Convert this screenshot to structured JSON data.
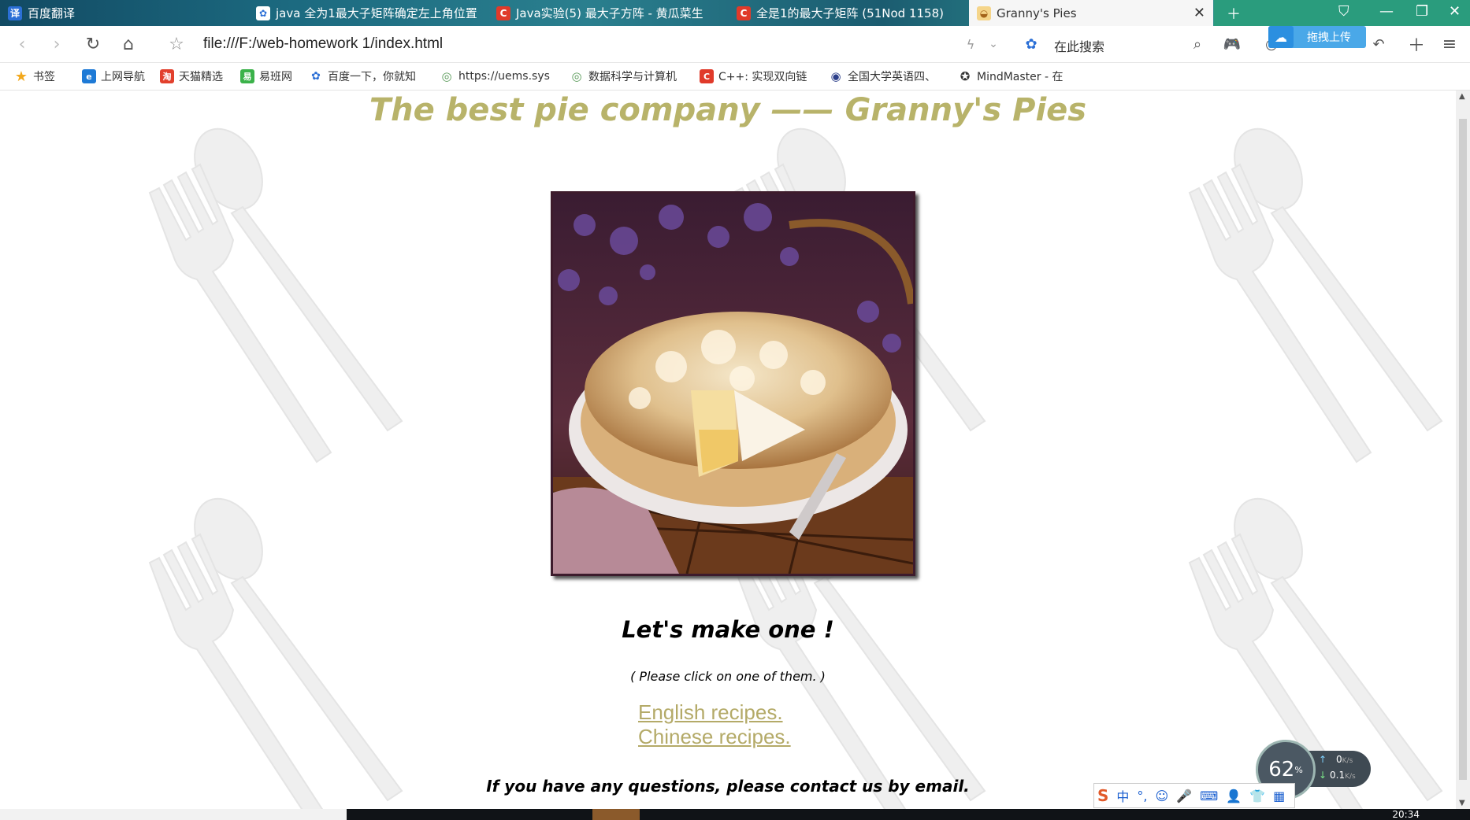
{
  "browser": {
    "tabs": [
      {
        "label": "百度翻译",
        "icon": "translate-icon",
        "color": "#2b6fd6",
        "glyph": "译"
      },
      {
        "label": "java 全为1最大子矩阵确定左上角位置",
        "icon": "baidu-paw-icon",
        "color": "#2b6fd6",
        "glyph": "✿"
      },
      {
        "label": "Java实验(5) 最大子方阵 - 黄瓜菜生",
        "icon": "csdn-icon",
        "color": "#e03a2a",
        "glyph": "C"
      },
      {
        "label": "全是1的最大子矩阵 (51Nod 1158)",
        "icon": "csdn-icon",
        "color": "#e03a2a",
        "glyph": "C"
      },
      {
        "label": "Granny's Pies",
        "icon": "pie-favicon-icon",
        "color": "#d79b33",
        "glyph": "◒"
      }
    ],
    "url": "file:///F:/web-homework 1/index.html",
    "search_label": "在此搜索",
    "upload_label": "拖拽上传",
    "bookmarks": [
      {
        "label": "书签",
        "icon": "star-icon",
        "color": "#f2a81d",
        "glyph": "★"
      },
      {
        "label": "上网导航",
        "icon": "ie-icon",
        "color": "#1e7ad6",
        "glyph": "e"
      },
      {
        "label": "天猫精选",
        "icon": "tmall-icon",
        "color": "#e2402d",
        "glyph": "淘"
      },
      {
        "label": "易班网",
        "icon": "yiban-icon",
        "color": "#3bb24a",
        "glyph": "易"
      },
      {
        "label": "百度一下，你就知",
        "icon": "baidu-paw-icon",
        "color": "#2b6fd6",
        "glyph": "✿"
      },
      {
        "label": "https://uems.sys",
        "icon": "globe-icon",
        "color": "#5a9b5a",
        "glyph": "◎"
      },
      {
        "label": "数据科学与计算机",
        "icon": "globe-icon",
        "color": "#5a9b5a",
        "glyph": "◎"
      },
      {
        "label": "C++: 实现双向链",
        "icon": "csdn-icon",
        "color": "#e03a2a",
        "glyph": "C"
      },
      {
        "label": "全国大学英语四、",
        "icon": "seal-icon",
        "color": "#2c3f8a",
        "glyph": "◉"
      },
      {
        "label": "MindMaster - 在",
        "icon": "mindmaster-icon",
        "color": "#333333",
        "glyph": "✪"
      }
    ]
  },
  "page": {
    "title": "The best pie company —— Granny's Pies",
    "heading": "Let's make one !",
    "hint": "( Please click on one of them. )",
    "links": [
      "English recipes.",
      "Chinese recipes."
    ],
    "contact": "If you have any questions, please contact us by email."
  },
  "system": {
    "net_percent": "62",
    "up_speed": "0",
    "down_speed": "0.1",
    "speed_unit": "K/s",
    "ime": [
      "中",
      "°,",
      "☺",
      "🎤",
      "⌨",
      "👤",
      "👕",
      "▦"
    ],
    "clock": "20:34"
  },
  "colors": {
    "title": "#b8b36a",
    "link": "#b4aa68"
  }
}
